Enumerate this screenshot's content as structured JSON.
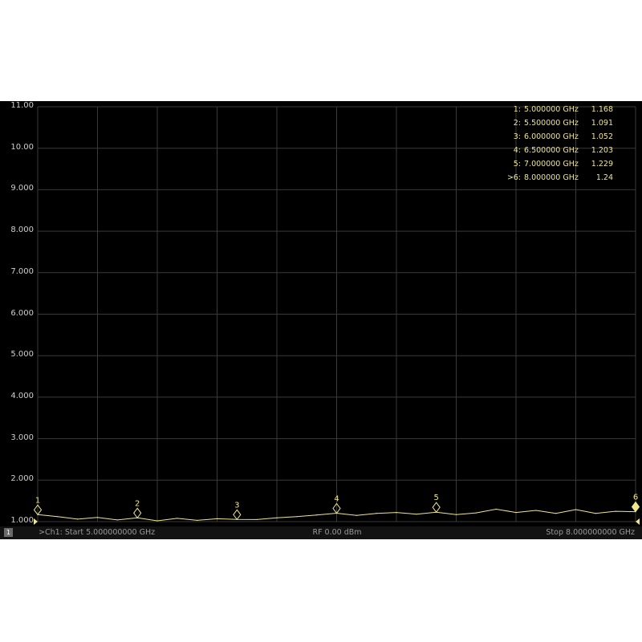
{
  "colors": {
    "background": "#000000",
    "grid": "#3a3a3a",
    "trace": "#f0e68c",
    "marker_text": "#f0e68c",
    "axis_text": "#cfcfcf",
    "status_text": "#9a9a9a"
  },
  "axis": {
    "y_ticks": [
      "11.00",
      "10.00",
      "9.000",
      "8.000",
      "7.000",
      "6.000",
      "5.000",
      "4.000",
      "3.000",
      "2.000",
      "1.000"
    ]
  },
  "markers": [
    {
      "id": "1:",
      "label": "1",
      "freq": "5.000000 GHz",
      "value": "1.168",
      "active": ""
    },
    {
      "id": "2:",
      "label": "2",
      "freq": "5.500000 GHz",
      "value": "1.091",
      "active": ""
    },
    {
      "id": "3:",
      "label": "3",
      "freq": "6.000000 GHz",
      "value": "1.052",
      "active": ""
    },
    {
      "id": "4:",
      "label": "4",
      "freq": "6.500000 GHz",
      "value": "1.203",
      "active": ""
    },
    {
      "id": "5:",
      "label": "5",
      "freq": "7.000000 GHz",
      "value": "1.229",
      "active": ""
    },
    {
      "id": "6:",
      "label": "6",
      "freq": "8.000000 GHz",
      "value": "1.24",
      "active": ">"
    }
  ],
  "status": {
    "channel_badge": "1",
    "start": ">Ch1: Start 5.000000000 GHz",
    "rf": "RF 0.00 dBm",
    "stop": "Stop 8.000000000 GHz"
  },
  "chart_data": {
    "type": "line",
    "x_unit": "GHz",
    "xlim": [
      5.0,
      8.0
    ],
    "ylim": [
      1.0,
      11.0
    ],
    "y_ticks": [
      11,
      10,
      9,
      8,
      7,
      6,
      5,
      4,
      3,
      2,
      1
    ],
    "grid": true,
    "series": [
      {
        "x": [
          5.0,
          5.1,
          5.2,
          5.3,
          5.4,
          5.5,
          5.6,
          5.7,
          5.8,
          5.9,
          6.0,
          6.1,
          6.2,
          6.3,
          6.4,
          6.5,
          6.6,
          6.7,
          6.8,
          6.9,
          7.0,
          7.1,
          7.2,
          7.3,
          7.4,
          7.5,
          7.6,
          7.7,
          7.8,
          7.9,
          8.0
        ],
        "values": [
          1.168,
          1.12,
          1.06,
          1.1,
          1.04,
          1.091,
          1.02,
          1.08,
          1.03,
          1.07,
          1.052,
          1.05,
          1.09,
          1.12,
          1.16,
          1.203,
          1.15,
          1.2,
          1.22,
          1.18,
          1.229,
          1.17,
          1.21,
          1.3,
          1.22,
          1.27,
          1.2,
          1.29,
          1.2,
          1.25,
          1.24
        ]
      }
    ]
  }
}
